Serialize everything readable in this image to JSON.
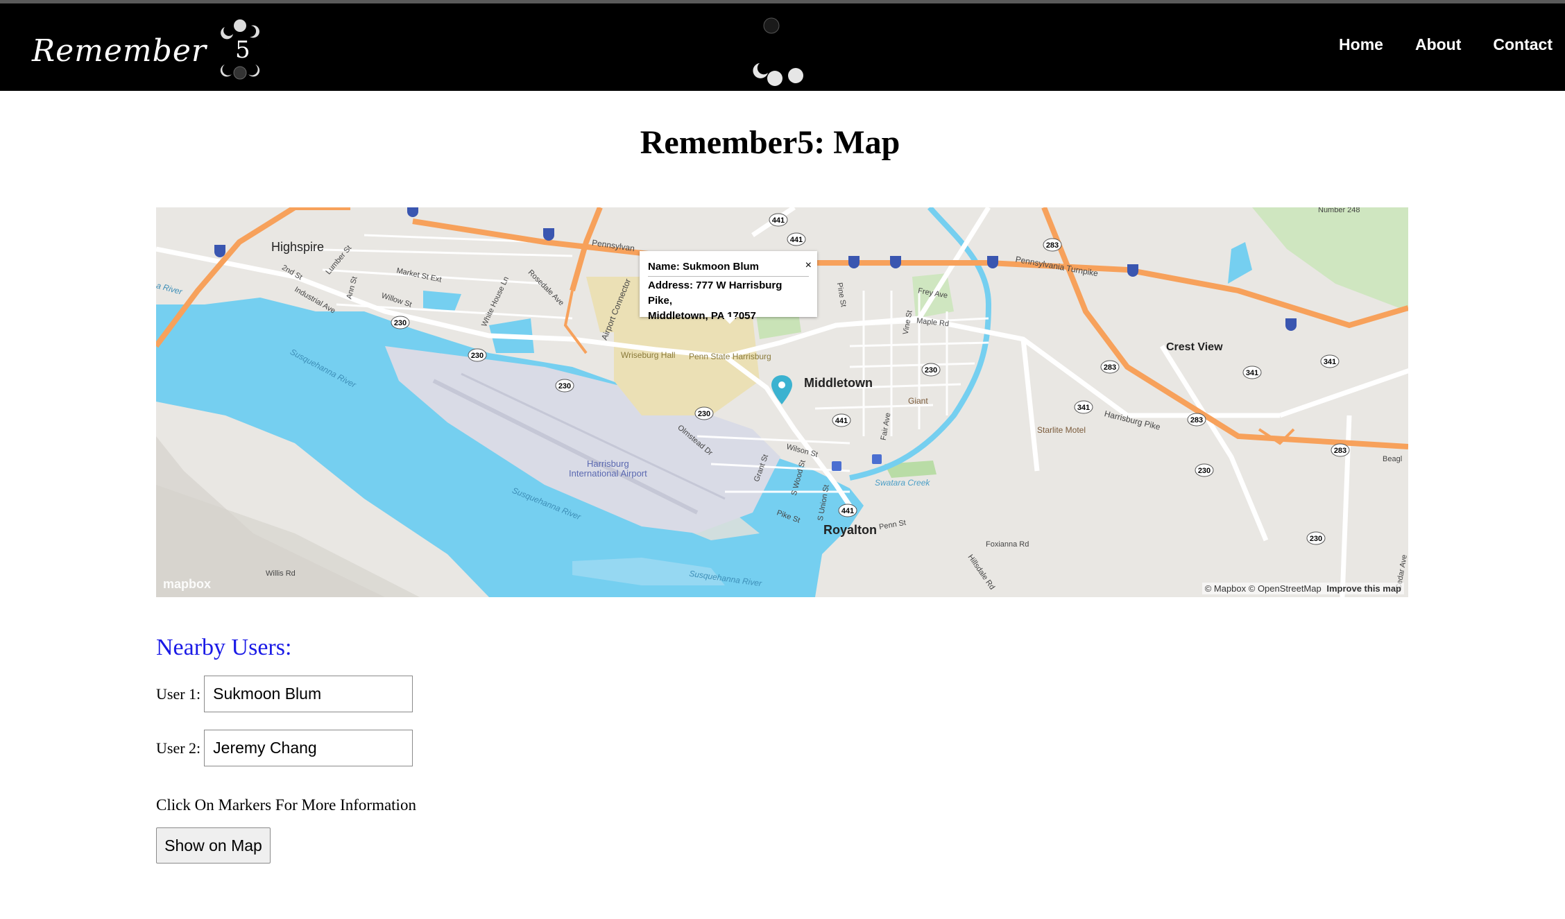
{
  "header": {
    "logo_text": "Remember",
    "logo_digit": "5",
    "nav": [
      {
        "label": "Home"
      },
      {
        "label": "About"
      },
      {
        "label": "Contact"
      }
    ]
  },
  "page_title": "Remember5: Map",
  "map": {
    "popup": {
      "name_label": "Name: Sukmoon Blum",
      "address_line1": "Address: 777 W Harrisburg Pike,",
      "address_line2": "Middletown, PA 17057",
      "close": "×"
    },
    "places": {
      "highspire": "Highspire",
      "middletown": "Middletown",
      "royalton": "Royalton",
      "crest_view": "Crest View",
      "harrisburg_airport_1": "Harrisburg",
      "harrisburg_airport_2": "International Airport",
      "penn_state": "Penn State Harrisburg",
      "wriseburg": "Wriseburg Hall",
      "giant": "Giant",
      "starlite": "Starlite Motel",
      "swatara_creek": "Swatara Creek",
      "susquehanna_1": "Susquehanna River",
      "susquehanna_2": "Susquehanna River",
      "susquehanna_3": "Susquehanna River",
      "penn_turnpike": "Pennsylvania Turnpike",
      "pennsylvan": "Pennsylvan",
      "airport_connector": "Airport Connector",
      "harrisburg_pike": "Harrisburg Pike",
      "foxianna": "Foxianna Rd",
      "willis": "Willis Rd",
      "number248": "Number 248",
      "market": "Market St Ext",
      "willow": "Willow St",
      "second": "2nd St",
      "industrial": "Industrial Ave",
      "rosedale": "Rosedale Ave",
      "white_house": "White House Ln",
      "lumber": "Lumber St",
      "ann": "Ann St",
      "frey": "Frey Ave",
      "maple": "Maple Rd",
      "vine": "Vine St",
      "pine": "Pine St",
      "olmstead": "Olmstead Dr",
      "wilson": "Wilson St",
      "grant": "Grant St",
      "wood": "S Wood St",
      "union": "S Union St",
      "pike": "Pike St",
      "penn": "Penn St",
      "fair": "Fair Ave",
      "hillsdale": "Hillsdale Rd",
      "beagl": "Beagl",
      "cedar": "Cedar Ave",
      "river_left": "a River"
    },
    "shields": [
      "230",
      "230",
      "230",
      "230",
      "230",
      "441",
      "441",
      "441",
      "441",
      "283",
      "283",
      "283",
      "283",
      "341",
      "341",
      "341",
      "230",
      "230"
    ],
    "attribution": "© Mapbox © OpenStreetMap",
    "improve": "Improve this map",
    "mapbox_logo": "mapbox"
  },
  "nearby": {
    "heading": "Nearby Users:",
    "users": [
      {
        "label": "User 1:",
        "value": "Sukmoon Blum"
      },
      {
        "label": "User 2:",
        "value": "Jeremy Chang"
      }
    ],
    "hint": "Click On Markers For More Information",
    "button": "Show on Map"
  },
  "colors": {
    "header_bg": "#000000",
    "heading_blue": "#1a1ae6",
    "water": "#75cff0",
    "highway": "#f7a15b",
    "airport": "#d9dbe6",
    "park": "#b9dca6",
    "campus": "#ebe0b5",
    "marker": "#3bb2d0"
  }
}
